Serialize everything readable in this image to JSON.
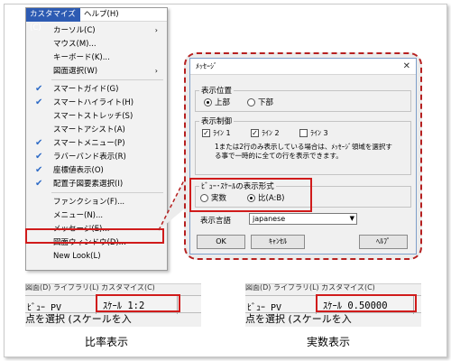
{
  "menu": {
    "bar": {
      "customize": "カスタマイズ(C)",
      "help": "ヘルプ(H)"
    },
    "items": [
      {
        "label": "カーソル(C)",
        "checked": false,
        "submenu": true
      },
      {
        "label": "マウス(M)...",
        "checked": false,
        "submenu": false
      },
      {
        "label": "キーボード(K)...",
        "checked": false,
        "submenu": false
      },
      {
        "label": "図面選択(W)",
        "checked": false,
        "submenu": true
      },
      {
        "label": "スマートガイド(G)",
        "checked": true,
        "submenu": false
      },
      {
        "label": "スマートハイライト(H)",
        "checked": true,
        "submenu": false
      },
      {
        "label": "スマートストレッチ(S)",
        "checked": false,
        "submenu": false
      },
      {
        "label": "スマートアシスト(A)",
        "checked": false,
        "submenu": false
      },
      {
        "label": "スマートメニュー(P)",
        "checked": true,
        "submenu": false
      },
      {
        "label": "ラバーバンド表示(R)",
        "checked": true,
        "submenu": false
      },
      {
        "label": "座標値表示(O)",
        "checked": true,
        "submenu": false
      },
      {
        "label": "配置子図要素選択(I)",
        "checked": true,
        "submenu": false
      },
      {
        "label": "ファンクション(F)...",
        "checked": false,
        "submenu": false
      },
      {
        "label": "メニュー(N)...",
        "checked": false,
        "submenu": false
      },
      {
        "label": "メッセージ(E)...",
        "checked": false,
        "submenu": false
      },
      {
        "label": "図面ウィンドウ(D)...",
        "checked": false,
        "submenu": false
      },
      {
        "label": "New Look(L)",
        "checked": false,
        "submenu": false
      }
    ]
  },
  "dialog": {
    "title": "ﾒｯｾｰｼﾞ",
    "position": {
      "legend": "表示位置",
      "top": "上部",
      "bottom": "下部"
    },
    "control": {
      "legend": "表示制御",
      "line1": "ﾗｲﾝ 1",
      "line2": "ﾗｲﾝ 2",
      "line3": "ﾗｲﾝ 3",
      "note": "1または2行のみ表示している場合は、ﾒｯｾｰｼﾞ領域を選択する事で一時的に全ての行を表示できます。"
    },
    "scale": {
      "legend": "ﾋﾞｭｰ･ｽｹｰﾙの表示形式",
      "real": "実数",
      "ratio": "比(A:B)"
    },
    "language": {
      "label": "表示言語",
      "value": "japanese"
    },
    "buttons": {
      "ok": "OK",
      "cancel": "ｷｬﾝｾﾙ",
      "help": "ﾍﾙﾌﾟ"
    }
  },
  "strips": {
    "ratio": {
      "top": "図面(D) ライブラリ(L) カスタマイズ(C)",
      "pv": "ﾋﾞｭｰ PV",
      "scale": "ｽｹｰﾙ 1:2",
      "bottom": "点を選択 (スケールを入"
    },
    "real": {
      "top": "図面(D) ライブラリ(L) カスタマイズ(C)",
      "pv": "ﾋﾞｭｰ PV",
      "scale": "ｽｹｰﾙ 0.50000",
      "bottom": "点を選択 (スケールを入"
    }
  },
  "captions": {
    "ratio": "比率表示",
    "real": "実数表示"
  }
}
